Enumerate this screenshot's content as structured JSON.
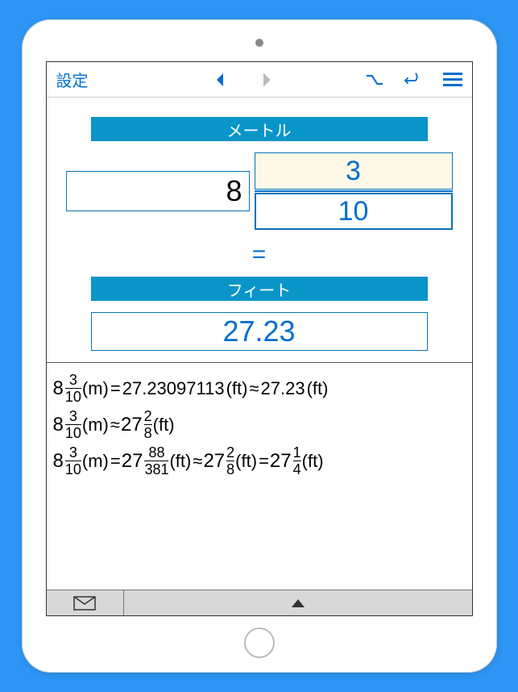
{
  "toolbar": {
    "settings_label": "設定"
  },
  "colors": {
    "accent": "#006fcf",
    "unit_bar": "#0a95c9",
    "input_bg": "#fdf8e8"
  },
  "conversion": {
    "from_unit_label": "メートル",
    "to_unit_label": "フィート",
    "whole": "8",
    "numerator": "3",
    "denominator": "10",
    "equals": "=",
    "result": "27.23"
  },
  "results": {
    "line1": {
      "lhs_whole": "8",
      "lhs_num": "3",
      "lhs_den": "10",
      "lhs_unit": "(m)",
      "eq": "=",
      "dec1": "27.23097113",
      "u1": "(ft)",
      "approx": "≈",
      "dec2": "27.23",
      "u2": "(ft)"
    },
    "line2": {
      "lhs_whole": "8",
      "lhs_num": "3",
      "lhs_den": "10",
      "lhs_unit": "(m)",
      "approx": "≈",
      "r_whole": "27",
      "r_num": "2",
      "r_den": "8",
      "r_unit": "(ft)"
    },
    "line3": {
      "lhs_whole": "8",
      "lhs_num": "3",
      "lhs_den": "10",
      "lhs_unit": "(m)",
      "eq": "=",
      "a_whole": "27",
      "a_num": "88",
      "a_den": "381",
      "a_unit": "(ft)",
      "approx": "≈",
      "b_whole": "27",
      "b_num": "2",
      "b_den": "8",
      "b_unit": "(ft)",
      "eq2": "=",
      "c_whole": "27",
      "c_num": "1",
      "c_den": "4",
      "c_unit": "(ft)"
    }
  }
}
